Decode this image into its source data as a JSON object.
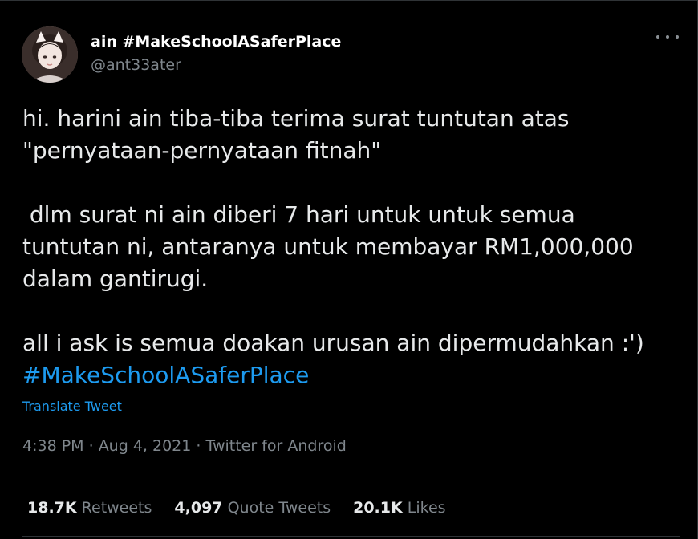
{
  "author": {
    "display_name": "ain #MakeSchoolASaferPlace",
    "handle": "@ant33ater"
  },
  "more_icon": "ellipsis-icon",
  "tweet": {
    "line1": "hi. harini ain tiba-tiba terima surat tuntutan atas",
    "line2": "\"pernyataan-pernyataan fitnah\"",
    "line3": " dlm surat ni ain diberi 7 hari untuk untuk semua",
    "line4": "tuntutan ni, antaranya untuk membayar RM1,000,000",
    "line5": "dalam gantirugi.",
    "line6": "all i ask is semua doakan urusan ain dipermudahkan :')",
    "hashtag": "#MakeSchoolASaferPlace"
  },
  "translate_label": "Translate Tweet",
  "meta": {
    "time": "4:38 PM",
    "sep1": " · ",
    "date": "Aug 4, 2021",
    "sep2": " · ",
    "source": "Twitter for Android"
  },
  "stats": {
    "retweets_count": "18.7K",
    "retweets_label": "Retweets",
    "quotes_count": "4,097",
    "quotes_label": "Quote Tweets",
    "likes_count": "20.1K",
    "likes_label": "Likes"
  },
  "colors": {
    "background": "#000000",
    "text": "#e7e9ea",
    "secondary": "#7f868c",
    "accent": "#1d9bf0",
    "divider": "#2f3336"
  }
}
